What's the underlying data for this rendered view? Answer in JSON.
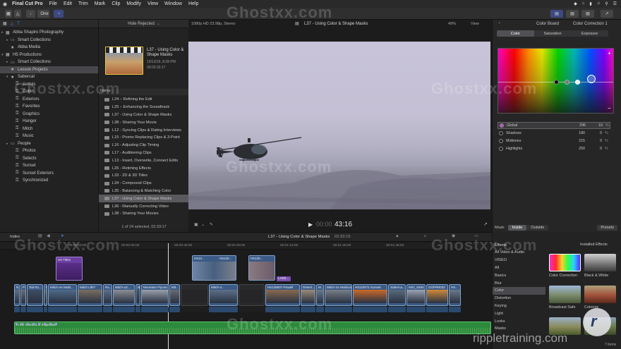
{
  "menubar": {
    "app": "Final Cut Pro",
    "items": [
      "File",
      "Edit",
      "Trim",
      "Mark",
      "Clip",
      "Modify",
      "View",
      "Window",
      "Help"
    ]
  },
  "toolbar": {
    "one_label": "One"
  },
  "library": {
    "header": "",
    "rows": [
      {
        "label": "Abba Shapiro Photography",
        "depth": 0,
        "icon": "library-icon",
        "tri": "▸"
      },
      {
        "label": "Smart Collections",
        "depth": 1,
        "icon": "folder-icon",
        "tri": "▸"
      },
      {
        "label": "Abba Media",
        "depth": 1,
        "icon": "event-icon",
        "tri": ""
      },
      {
        "label": "H5 Productions",
        "depth": 0,
        "icon": "library-icon",
        "tri": "▾"
      },
      {
        "label": "Smart Collections",
        "depth": 1,
        "icon": "folder-icon",
        "tri": "▸"
      },
      {
        "label": "Lesson Projects",
        "depth": 1,
        "icon": "event-icon",
        "tri": "",
        "selected": true
      },
      {
        "label": "Sabercat",
        "depth": 1,
        "icon": "event-icon",
        "tri": "▾"
      },
      {
        "label": "Aerials",
        "depth": 2,
        "icon": "keyword-icon",
        "tri": ""
      },
      {
        "label": "Cubin",
        "depth": 2,
        "icon": "keyword-icon",
        "tri": ""
      },
      {
        "label": "Exteriors",
        "depth": 2,
        "icon": "keyword-icon",
        "tri": ""
      },
      {
        "label": "Favorites",
        "depth": 2,
        "icon": "keyword-icon",
        "tri": ""
      },
      {
        "label": "Graphics",
        "depth": 2,
        "icon": "keyword-icon",
        "tri": ""
      },
      {
        "label": "Hanger",
        "depth": 2,
        "icon": "keyword-icon",
        "tri": ""
      },
      {
        "label": "Mitch",
        "depth": 2,
        "icon": "keyword-icon",
        "tri": ""
      },
      {
        "label": "Music",
        "depth": 2,
        "icon": "keyword-icon",
        "tri": ""
      },
      {
        "label": "People",
        "depth": 1,
        "icon": "folder-icon",
        "tri": "▸"
      },
      {
        "label": "Photos",
        "depth": 2,
        "icon": "keyword-icon",
        "tri": ""
      },
      {
        "label": "Selects",
        "depth": 2,
        "icon": "keyword-icon",
        "tri": ""
      },
      {
        "label": "Sunset",
        "depth": 2,
        "icon": "keyword-icon",
        "tri": ""
      },
      {
        "label": "Sunset Exteriors",
        "depth": 2,
        "icon": "keyword-icon",
        "tri": ""
      },
      {
        "label": "Synchronized",
        "depth": 2,
        "icon": "keyword-icon",
        "tri": ""
      }
    ]
  },
  "browser": {
    "filter": "Hide Rejected",
    "preview": {
      "title": "L37 - Using Color & Shape Masks",
      "date": "10/13/16, 8:28 PM",
      "duration": "00:02:33:17"
    },
    "column_name": "Name",
    "clips": [
      "L24 – Refining the Edit",
      "L25 – Enhancing the Soundtrack",
      "L37 - Using Color & Shape Masks",
      "L38 - Sharing Your Movie",
      "L12 - Syncing Clips & Rating Interviews",
      "L15 - Promo Replacing Clips & 3-Point",
      "L16 - Adjusting Clip Timing",
      "L17 - Auditioning Clips",
      "L13 - Insert, Overwrite, Connect Edits",
      "L26 - Retiming Effects",
      "L33 - 2D & 3D Titles",
      "L34 - Compound Clips",
      "L35 - Balancing & Matching Color",
      "L37 - Using Color & Shape Masks",
      "L36 - Manually Correcting Video",
      "L38 - Sharing Your Movies"
    ],
    "selected_index": 13,
    "footer": "1 of 24 selected, 02:33:17"
  },
  "viewer": {
    "format": "1080p HD 23.98p, Stereo",
    "title": "L37 - Using Color & Shape Masks",
    "zoom": "49%",
    "view_label": "View",
    "timecode": "43:16",
    "timecode_dim": "00:00"
  },
  "inspector": {
    "title": "Color Board",
    "correction": "Color Correction 1",
    "tabs": [
      "Color",
      "Saturation",
      "Exposure"
    ],
    "rows": [
      {
        "label": "Global",
        "value": "296",
        "pct": "10",
        "selected": true
      },
      {
        "label": "Shadows",
        "value": "180",
        "pct": "0",
        "selected": false
      },
      {
        "label": "Midtones",
        "value": "215",
        "pct": "0",
        "selected": false
      },
      {
        "label": "Highlights",
        "value": "250",
        "pct": "0",
        "selected": false
      }
    ],
    "mask_label": "Mask:",
    "inside": "Inside",
    "outside": "Outside",
    "presets": "Presets"
  },
  "timeline": {
    "index": "Index",
    "project": "L37 - Using Color & Shape Masks",
    "duration": "02:33:15",
    "ruler": [
      "00:00:15:00",
      "00:00:30:00",
      "00:00:45:00",
      "00:01:00:00",
      "00:01:15:00",
      "00:01:30:00",
      "00:01:45:00"
    ],
    "upper_clips": [
      {
        "name": "H5 Titles",
        "color": "#6b3fa0"
      },
      {
        "name": "H513...",
        "color": "#3b5b86"
      },
      {
        "name": "H5130...",
        "color": "#3b5b86"
      },
      {
        "name": "H5130...",
        "color": "#3b5b86"
      }
    ],
    "primary_clips": [
      "N...",
      "P...",
      "Tail Ro...",
      "N...",
      "Mitch-4A Multi...",
      "Mitch Life?",
      "Ro...",
      "Mitch-LE...",
      "N...",
      "Mountain Flyove...",
      "Mit...",
      "",
      "Mitch-4...",
      "",
      "H5130607-Powell",
      "Desert...",
      "M...",
      "Mitch-4A Multicam",
      "H5110571-Sunset",
      "Saberca...",
      "IMG_5493",
      "GOPR0032",
      "H5..."
    ],
    "connected": "LAKE...",
    "audio_label": "In the moment of Inspiration"
  },
  "effects": {
    "header": "Effects",
    "installed": "Installed Effects",
    "categories": [
      "All Video & Audio",
      "VIDEO",
      "All",
      "Basics",
      "Blur",
      "Color",
      "Distortion",
      "Keying",
      "Light",
      "Looks",
      "Masks"
    ],
    "selected_category": 5,
    "thumbs": [
      {
        "label": "Color Correction",
        "selected": true
      },
      {
        "label": "Black & White",
        "selected": false
      },
      {
        "label": "Broadcast Safe",
        "selected": false
      },
      {
        "label": "Colorize",
        "selected": false
      },
      {
        "label": "",
        "selected": false
      },
      {
        "label": "",
        "selected": false
      }
    ],
    "count": "7 items"
  },
  "watermarks": {
    "main": "Ghostxx.com",
    "credit": "rippletraining.com"
  }
}
